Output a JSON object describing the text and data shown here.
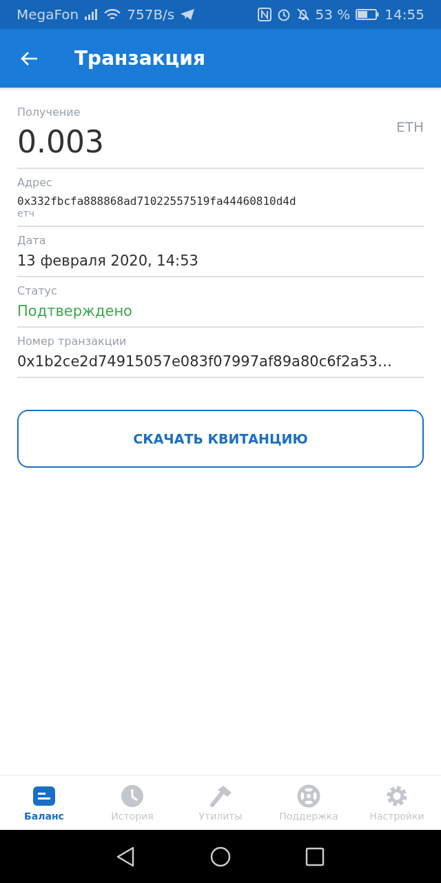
{
  "status_bar": {
    "carrier": "MegaFon",
    "speed": "757B/s",
    "battery": "53 %",
    "time": "14:55"
  },
  "app_bar": {
    "title": "Транзакция"
  },
  "amount": {
    "label": "Получение",
    "value": "0.003",
    "currency": "ETH"
  },
  "fields": [
    {
      "kind": "address",
      "label": "Адрес",
      "value": "0x332fbcfa888868ad71022557519fa44460810d4d",
      "note": "етч"
    },
    {
      "kind": "text",
      "label": "Дата",
      "value": "13 февраля 2020, 14:53"
    },
    {
      "kind": "status",
      "label": "Статус",
      "value": "Подтверждено"
    },
    {
      "kind": "text",
      "label": "Номер транзакции",
      "value": "0x1b2ce2d74915057e083f07997af89a80c6f2a53…"
    }
  ],
  "download_button": "СКАЧАТЬ КВИТАНЦИЮ",
  "tabs": [
    {
      "kind": "balance",
      "label": "Баланс",
      "selected": true
    },
    {
      "kind": "history",
      "label": "История",
      "selected": false
    },
    {
      "kind": "tools",
      "label": "Утилиты",
      "selected": false
    },
    {
      "kind": "support",
      "label": "Поддержка",
      "selected": false
    },
    {
      "kind": "settings",
      "label": "Настройки",
      "selected": false
    }
  ]
}
